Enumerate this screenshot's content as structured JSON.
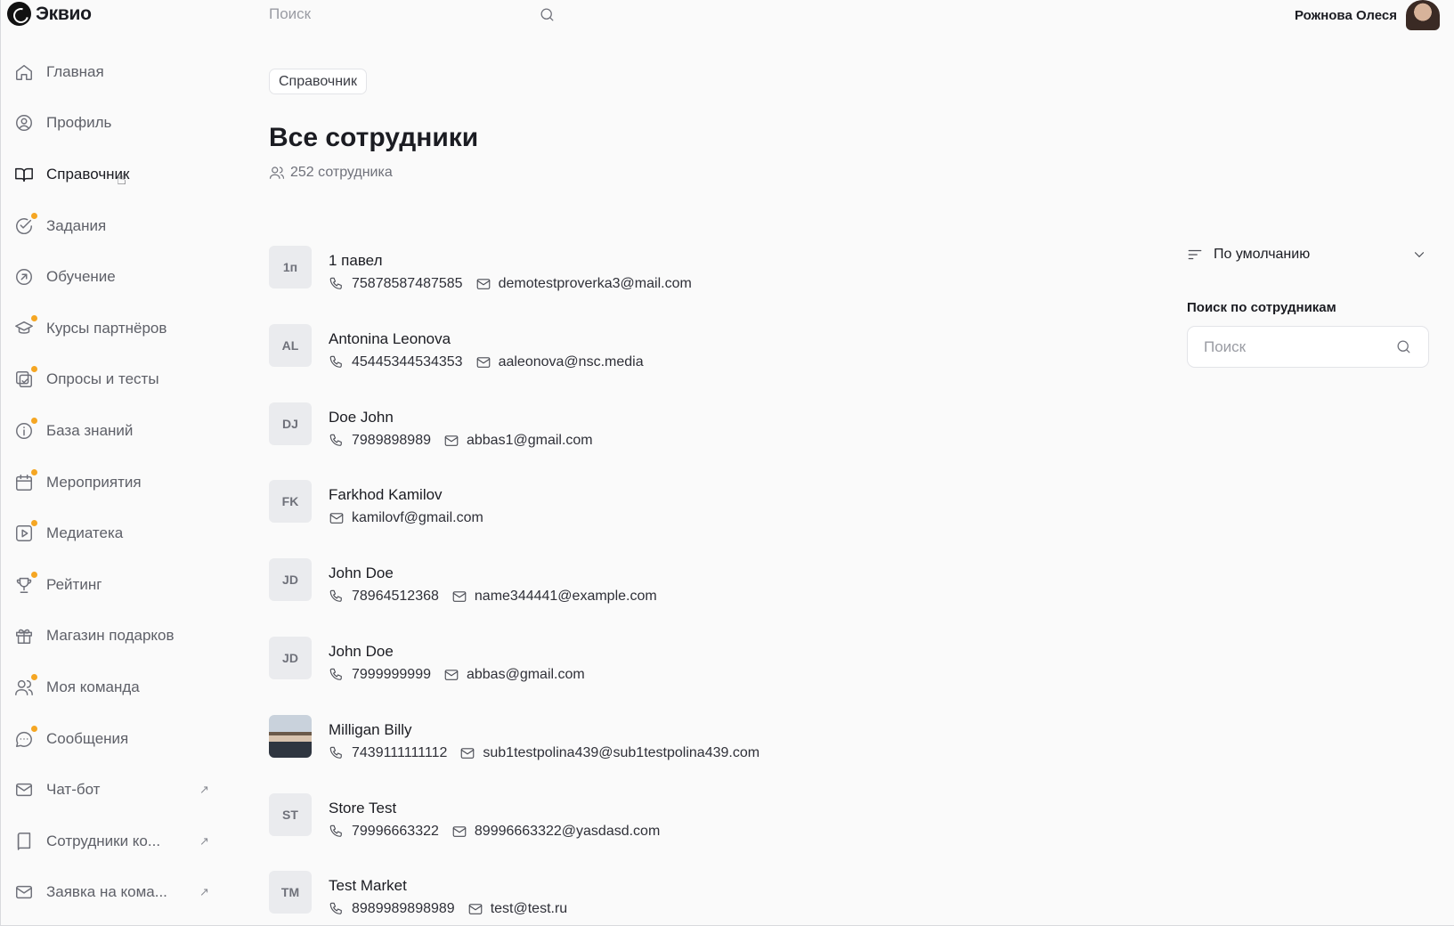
{
  "header": {
    "logo_text": "Эквио",
    "search_placeholder": "Поиск",
    "user_name": "Рожнова Олеся"
  },
  "sidebar": {
    "items": [
      {
        "label": "Главная",
        "icon": "home-icon",
        "dot": false,
        "external": false,
        "active": false
      },
      {
        "label": "Профиль",
        "icon": "user-circle-icon",
        "dot": false,
        "external": false,
        "active": false
      },
      {
        "label": "Справочник",
        "icon": "book-open-icon",
        "dot": false,
        "external": false,
        "active": true
      },
      {
        "label": "Задания",
        "icon": "check-circle-icon",
        "dot": true,
        "external": false,
        "active": false
      },
      {
        "label": "Обучение",
        "icon": "learning-icon",
        "dot": false,
        "external": false,
        "active": false
      },
      {
        "label": "Курсы партнёров",
        "icon": "graduation-cap-icon",
        "dot": true,
        "external": false,
        "active": false
      },
      {
        "label": "Опросы и тесты",
        "icon": "survey-icon",
        "dot": true,
        "external": false,
        "active": false
      },
      {
        "label": "База знаний",
        "icon": "info-icon",
        "dot": true,
        "external": false,
        "active": false
      },
      {
        "label": "Мероприятия",
        "icon": "calendar-icon",
        "dot": true,
        "external": false,
        "active": false
      },
      {
        "label": "Медиатека",
        "icon": "play-icon",
        "dot": true,
        "external": false,
        "active": false
      },
      {
        "label": "Рейтинг",
        "icon": "trophy-icon",
        "dot": true,
        "external": false,
        "active": false
      },
      {
        "label": "Магазин подарков",
        "icon": "gift-icon",
        "dot": false,
        "external": false,
        "active": false
      },
      {
        "label": "Моя команда",
        "icon": "team-icon",
        "dot": true,
        "external": false,
        "active": false
      },
      {
        "label": "Сообщения",
        "icon": "chat-icon",
        "dot": true,
        "external": false,
        "active": false
      },
      {
        "label": "Чат-бот",
        "icon": "mail-icon",
        "dot": false,
        "external": true,
        "active": false
      },
      {
        "label": "Сотрудники ко...",
        "icon": "book-icon",
        "dot": false,
        "external": true,
        "active": false
      },
      {
        "label": "Заявка на кома...",
        "icon": "mail-icon",
        "dot": false,
        "external": true,
        "active": false
      }
    ],
    "external_glyph": "↗"
  },
  "main": {
    "breadcrumb": "Справочник",
    "title": "Все сотрудники",
    "count": "252 сотрудника"
  },
  "employees": [
    {
      "initials": "1п",
      "name": "1 павел",
      "phone": "75878587487585",
      "email": "demotestproverka3@mail.com",
      "photo": false
    },
    {
      "initials": "AL",
      "name": "Antonina Leonova",
      "phone": "45445344534353",
      "email": "aaleonova@nsc.media",
      "photo": false
    },
    {
      "initials": "DJ",
      "name": "Doe John",
      "phone": "7989898989",
      "email": "abbas1@gmail.com",
      "photo": false
    },
    {
      "initials": "FK",
      "name": "Farkhod Kamilov",
      "phone": "",
      "email": "kamilovf@gmail.com",
      "photo": false
    },
    {
      "initials": "JD",
      "name": "John Doe",
      "phone": "78964512368",
      "email": "name344441@example.com",
      "photo": false
    },
    {
      "initials": "JD",
      "name": "John Doe",
      "phone": "7999999999",
      "email": "abbas@gmail.com",
      "photo": false
    },
    {
      "initials": "",
      "name": "Milligan Billy",
      "phone": "7439111111112",
      "email": "sub1testpolina439@sub1testpolina439.com",
      "photo": true
    },
    {
      "initials": "ST",
      "name": "Store Test",
      "phone": "79996663322",
      "email": "89996663322@yasdasd.com",
      "photo": false
    },
    {
      "initials": "TM",
      "name": "Test Market",
      "phone": "8989989898989",
      "email": "test@test.ru",
      "photo": false
    }
  ],
  "right_panel": {
    "sort_label": "По умолчанию",
    "search_label": "Поиск по сотрудникам",
    "search_placeholder": "Поиск"
  },
  "colors": {
    "accent_dot": "#f5a623",
    "background": "#fafafa"
  }
}
